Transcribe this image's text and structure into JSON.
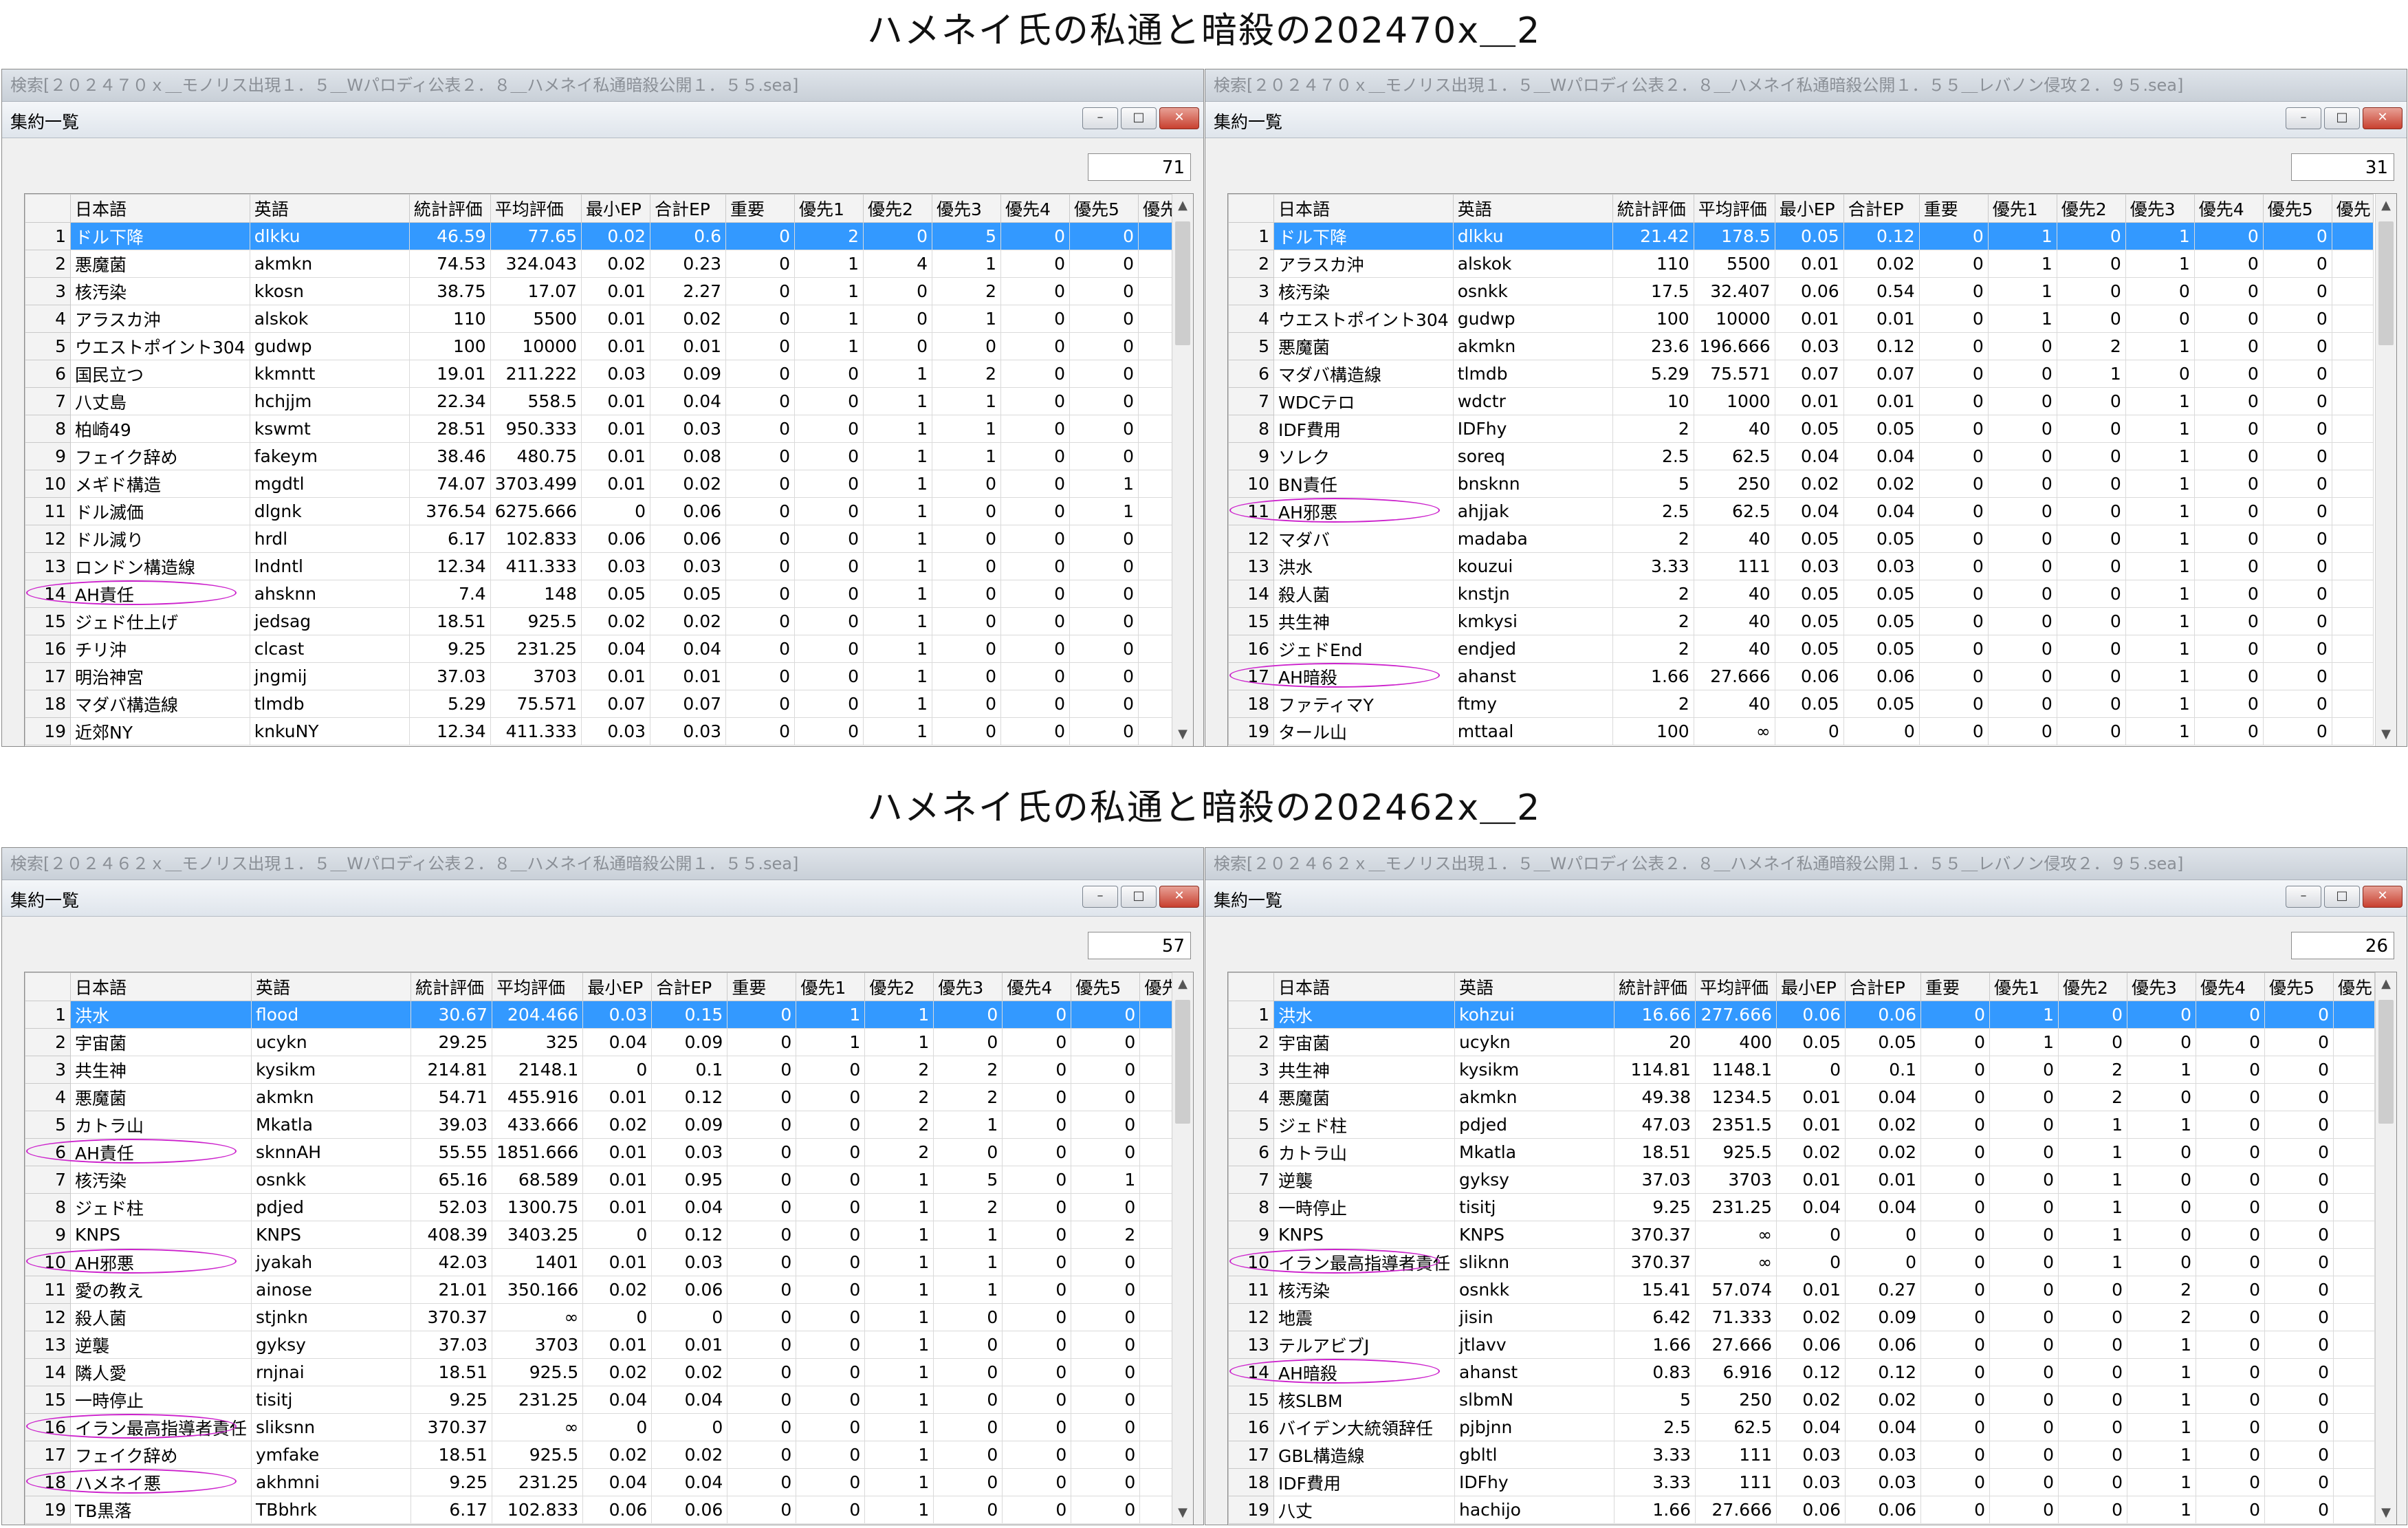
{
  "title_top": "ハメネイ氏の私通と暗殺の202470x＿2",
  "title_bottom": "ハメネイ氏の私通と暗殺の202462x＿2",
  "subwindow_label": "集約一覧",
  "controls": {
    "minimize": "–",
    "maximize": "□",
    "close": "✕"
  },
  "columns": [
    "",
    "日本語",
    "英語",
    "統計評価",
    "平均評価",
    "最小EP",
    "合計EP",
    "重要",
    "優先1",
    "優先2",
    "優先3",
    "優先4",
    "優先5",
    "優先"
  ],
  "highlight_color": "#cc22cc",
  "windows": [
    {
      "title": "検索[２０２４７０ｘ＿モノリス出現１．５＿Wパロディ公表２．８＿ハメネイ私通暗殺公開１．５５.sea]",
      "count": "71",
      "rows": [
        [
          "1",
          "ドル下降",
          "dlkku",
          "46.59",
          "77.65",
          "0.02",
          "0.6",
          "0",
          "2",
          "0",
          "5",
          "0",
          "0"
        ],
        [
          "2",
          "悪魔菌",
          "akmkn",
          "74.53",
          "324.043",
          "0.02",
          "0.23",
          "0",
          "1",
          "4",
          "1",
          "0",
          "0"
        ],
        [
          "3",
          "核汚染",
          "kkosn",
          "38.75",
          "17.07",
          "0.01",
          "2.27",
          "0",
          "1",
          "0",
          "2",
          "0",
          "0"
        ],
        [
          "4",
          "アラスカ沖",
          "alskok",
          "110",
          "5500",
          "0.01",
          "0.02",
          "0",
          "1",
          "0",
          "1",
          "0",
          "0"
        ],
        [
          "5",
          "ウエストポイント304",
          "gudwp",
          "100",
          "10000",
          "0.01",
          "0.01",
          "0",
          "1",
          "0",
          "0",
          "0",
          "0"
        ],
        [
          "6",
          "国民立つ",
          "kkmntt",
          "19.01",
          "211.222",
          "0.03",
          "0.09",
          "0",
          "0",
          "1",
          "2",
          "0",
          "0"
        ],
        [
          "7",
          "八丈島",
          "hchjjm",
          "22.34",
          "558.5",
          "0.01",
          "0.04",
          "0",
          "0",
          "1",
          "1",
          "0",
          "0"
        ],
        [
          "8",
          "柏崎49",
          "kswmt",
          "28.51",
          "950.333",
          "0.01",
          "0.03",
          "0",
          "0",
          "1",
          "1",
          "0",
          "0"
        ],
        [
          "9",
          "フェイク辞め",
          "fakeym",
          "38.46",
          "480.75",
          "0.01",
          "0.08",
          "0",
          "0",
          "1",
          "1",
          "0",
          "0"
        ],
        [
          "10",
          "メギド構造",
          "mgdtl",
          "74.07",
          "3703.499",
          "0.01",
          "0.02",
          "0",
          "0",
          "1",
          "0",
          "0",
          "1"
        ],
        [
          "11",
          "ドル滅価",
          "dlgnk",
          "376.54",
          "6275.666",
          "0",
          "0.06",
          "0",
          "0",
          "1",
          "0",
          "0",
          "1"
        ],
        [
          "12",
          "ドル減り",
          "hrdl",
          "6.17",
          "102.833",
          "0.06",
          "0.06",
          "0",
          "0",
          "1",
          "0",
          "0",
          "0"
        ],
        [
          "13",
          "ロンドン構造線",
          "lndntl",
          "12.34",
          "411.333",
          "0.03",
          "0.03",
          "0",
          "0",
          "1",
          "0",
          "0",
          "0"
        ],
        [
          "14",
          "AH責任",
          "ahsknn",
          "7.4",
          "148",
          "0.05",
          "0.05",
          "0",
          "0",
          "1",
          "0",
          "0",
          "0"
        ],
        [
          "15",
          "ジェド仕上げ",
          "jedsag",
          "18.51",
          "925.5",
          "0.02",
          "0.02",
          "0",
          "0",
          "1",
          "0",
          "0",
          "0"
        ],
        [
          "16",
          "チリ沖",
          "clcast",
          "9.25",
          "231.25",
          "0.04",
          "0.04",
          "0",
          "0",
          "1",
          "0",
          "0",
          "0"
        ],
        [
          "17",
          "明治神宮",
          "jngmij",
          "37.03",
          "3703",
          "0.01",
          "0.01",
          "0",
          "0",
          "1",
          "0",
          "0",
          "0"
        ],
        [
          "18",
          "マダバ構造線",
          "tlmdb",
          "5.29",
          "75.571",
          "0.07",
          "0.07",
          "0",
          "0",
          "1",
          "0",
          "0",
          "0"
        ],
        [
          "19",
          "近郊NY",
          "knkuNY",
          "12.34",
          "411.333",
          "0.03",
          "0.03",
          "0",
          "0",
          "1",
          "0",
          "0",
          "0"
        ]
      ]
    },
    {
      "title": "検索[２０２４７０ｘ＿モノリス出現１．５＿Wパロディ公表２．８＿ハメネイ私通暗殺公開１．５５＿レバノン侵攻２．９５.sea]",
      "count": "31",
      "rows": [
        [
          "1",
          "ドル下降",
          "dlkku",
          "21.42",
          "178.5",
          "0.05",
          "0.12",
          "0",
          "1",
          "0",
          "1",
          "0",
          "0"
        ],
        [
          "2",
          "アラスカ沖",
          "alskok",
          "110",
          "5500",
          "0.01",
          "0.02",
          "0",
          "1",
          "0",
          "1",
          "0",
          "0"
        ],
        [
          "3",
          "核汚染",
          "osnkk",
          "17.5",
          "32.407",
          "0.06",
          "0.54",
          "0",
          "1",
          "0",
          "0",
          "0",
          "0"
        ],
        [
          "4",
          "ウエストポイント304",
          "gudwp",
          "100",
          "10000",
          "0.01",
          "0.01",
          "0",
          "1",
          "0",
          "0",
          "0",
          "0"
        ],
        [
          "5",
          "悪魔菌",
          "akmkn",
          "23.6",
          "196.666",
          "0.03",
          "0.12",
          "0",
          "0",
          "2",
          "1",
          "0",
          "0"
        ],
        [
          "6",
          "マダバ構造線",
          "tlmdb",
          "5.29",
          "75.571",
          "0.07",
          "0.07",
          "0",
          "0",
          "1",
          "0",
          "0",
          "0"
        ],
        [
          "7",
          "WDCテロ",
          "wdctr",
          "10",
          "1000",
          "0.01",
          "0.01",
          "0",
          "0",
          "0",
          "1",
          "0",
          "0"
        ],
        [
          "8",
          "IDF費用",
          "IDFhy",
          "2",
          "40",
          "0.05",
          "0.05",
          "0",
          "0",
          "0",
          "1",
          "0",
          "0"
        ],
        [
          "9",
          "ソレク",
          "soreq",
          "2.5",
          "62.5",
          "0.04",
          "0.04",
          "0",
          "0",
          "0",
          "1",
          "0",
          "0"
        ],
        [
          "10",
          "BN責任",
          "bnsknn",
          "5",
          "250",
          "0.02",
          "0.02",
          "0",
          "0",
          "0",
          "1",
          "0",
          "0"
        ],
        [
          "11",
          "AH邪悪",
          "ahjjak",
          "2.5",
          "62.5",
          "0.04",
          "0.04",
          "0",
          "0",
          "0",
          "1",
          "0",
          "0"
        ],
        [
          "12",
          "マダバ",
          "madaba",
          "2",
          "40",
          "0.05",
          "0.05",
          "0",
          "0",
          "0",
          "1",
          "0",
          "0"
        ],
        [
          "13",
          "洪水",
          "kouzui",
          "3.33",
          "111",
          "0.03",
          "0.03",
          "0",
          "0",
          "0",
          "1",
          "0",
          "0"
        ],
        [
          "14",
          "殺人菌",
          "knstjn",
          "2",
          "40",
          "0.05",
          "0.05",
          "0",
          "0",
          "0",
          "1",
          "0",
          "0"
        ],
        [
          "15",
          "共生神",
          "kmkysi",
          "2",
          "40",
          "0.05",
          "0.05",
          "0",
          "0",
          "0",
          "1",
          "0",
          "0"
        ],
        [
          "16",
          "ジェドEnd",
          "endjed",
          "2",
          "40",
          "0.05",
          "0.05",
          "0",
          "0",
          "0",
          "1",
          "0",
          "0"
        ],
        [
          "17",
          "AH暗殺",
          "ahanst",
          "1.66",
          "27.666",
          "0.06",
          "0.06",
          "0",
          "0",
          "0",
          "1",
          "0",
          "0"
        ],
        [
          "18",
          "ファティマY",
          "ftmy",
          "2",
          "40",
          "0.05",
          "0.05",
          "0",
          "0",
          "0",
          "1",
          "0",
          "0"
        ],
        [
          "19",
          "タール山",
          "mttaal",
          "100",
          "∞",
          "0",
          "0",
          "0",
          "0",
          "0",
          "1",
          "0",
          "0"
        ]
      ]
    },
    {
      "title": "検索[２０２４６２ｘ＿モノリス出現１．５＿Wパロディ公表２．８＿ハメネイ私通暗殺公開１．５５.sea]",
      "count": "57",
      "rows": [
        [
          "1",
          "洪水",
          "flood",
          "30.67",
          "204.466",
          "0.03",
          "0.15",
          "0",
          "1",
          "1",
          "0",
          "0",
          "0"
        ],
        [
          "2",
          "宇宙菌",
          "ucykn",
          "29.25",
          "325",
          "0.04",
          "0.09",
          "0",
          "1",
          "1",
          "0",
          "0",
          "0"
        ],
        [
          "3",
          "共生神",
          "kysikm",
          "214.81",
          "2148.1",
          "0",
          "0.1",
          "0",
          "0",
          "2",
          "2",
          "0",
          "0"
        ],
        [
          "4",
          "悪魔菌",
          "akmkn",
          "54.71",
          "455.916",
          "0.01",
          "0.12",
          "0",
          "0",
          "2",
          "2",
          "0",
          "0"
        ],
        [
          "5",
          "カトラ山",
          "Mkatla",
          "39.03",
          "433.666",
          "0.02",
          "0.09",
          "0",
          "0",
          "2",
          "1",
          "0",
          "0"
        ],
        [
          "6",
          "AH責任",
          "sknnAH",
          "55.55",
          "1851.666",
          "0.01",
          "0.03",
          "0",
          "0",
          "2",
          "0",
          "0",
          "0"
        ],
        [
          "7",
          "核汚染",
          "osnkk",
          "65.16",
          "68.589",
          "0.01",
          "0.95",
          "0",
          "0",
          "1",
          "5",
          "0",
          "1"
        ],
        [
          "8",
          "ジェド柱",
          "pdjed",
          "52.03",
          "1300.75",
          "0.01",
          "0.04",
          "0",
          "0",
          "1",
          "2",
          "0",
          "0"
        ],
        [
          "9",
          "KNPS",
          "KNPS",
          "408.39",
          "3403.25",
          "0",
          "0.12",
          "0",
          "0",
          "1",
          "1",
          "0",
          "2"
        ],
        [
          "10",
          "AH邪悪",
          "jyakah",
          "42.03",
          "1401",
          "0.01",
          "0.03",
          "0",
          "0",
          "1",
          "1",
          "0",
          "0"
        ],
        [
          "11",
          "愛の教え",
          "ainose",
          "21.01",
          "350.166",
          "0.02",
          "0.06",
          "0",
          "0",
          "1",
          "1",
          "0",
          "0"
        ],
        [
          "12",
          "殺人菌",
          "stjnkn",
          "370.37",
          "∞",
          "0",
          "0",
          "0",
          "0",
          "1",
          "0",
          "0",
          "0"
        ],
        [
          "13",
          "逆襲",
          "gyksy",
          "37.03",
          "3703",
          "0.01",
          "0.01",
          "0",
          "0",
          "1",
          "0",
          "0",
          "0"
        ],
        [
          "14",
          "隣人愛",
          "rnjnai",
          "18.51",
          "925.5",
          "0.02",
          "0.02",
          "0",
          "0",
          "1",
          "0",
          "0",
          "0"
        ],
        [
          "15",
          "一時停止",
          "tisitj",
          "9.25",
          "231.25",
          "0.04",
          "0.04",
          "0",
          "0",
          "1",
          "0",
          "0",
          "0"
        ],
        [
          "16",
          "イラン最高指導者責任",
          "sliksnn",
          "370.37",
          "∞",
          "0",
          "0",
          "0",
          "0",
          "1",
          "0",
          "0",
          "0"
        ],
        [
          "17",
          "フェイク辞め",
          "ymfake",
          "18.51",
          "925.5",
          "0.02",
          "0.02",
          "0",
          "0",
          "1",
          "0",
          "0",
          "0"
        ],
        [
          "18",
          "ハメネイ悪",
          "akhmni",
          "9.25",
          "231.25",
          "0.04",
          "0.04",
          "0",
          "0",
          "1",
          "0",
          "0",
          "0"
        ],
        [
          "19",
          "TB黒落",
          "TBbhrk",
          "6.17",
          "102.833",
          "0.06",
          "0.06",
          "0",
          "0",
          "1",
          "0",
          "0",
          "0"
        ]
      ]
    },
    {
      "title": "検索[２０２４６２ｘ＿モノリス出現１．５＿Wパロディ公表２．８＿ハメネイ私通暗殺公開１．５５＿レバノン侵攻２．９５.sea]",
      "count": "26",
      "rows": [
        [
          "1",
          "洪水",
          "kohzui",
          "16.66",
          "277.666",
          "0.06",
          "0.06",
          "0",
          "1",
          "0",
          "0",
          "0",
          "0"
        ],
        [
          "2",
          "宇宙菌",
          "ucykn",
          "20",
          "400",
          "0.05",
          "0.05",
          "0",
          "1",
          "0",
          "0",
          "0",
          "0"
        ],
        [
          "3",
          "共生神",
          "kysikm",
          "114.81",
          "1148.1",
          "0",
          "0.1",
          "0",
          "0",
          "2",
          "1",
          "0",
          "0"
        ],
        [
          "4",
          "悪魔菌",
          "akmkn",
          "49.38",
          "1234.5",
          "0.01",
          "0.04",
          "0",
          "0",
          "2",
          "0",
          "0",
          "0"
        ],
        [
          "5",
          "ジェド柱",
          "pdjed",
          "47.03",
          "2351.5",
          "0.01",
          "0.02",
          "0",
          "0",
          "1",
          "1",
          "0",
          "0"
        ],
        [
          "6",
          "カトラ山",
          "Mkatla",
          "18.51",
          "925.5",
          "0.02",
          "0.02",
          "0",
          "0",
          "1",
          "0",
          "0",
          "0"
        ],
        [
          "7",
          "逆襲",
          "gyksy",
          "37.03",
          "3703",
          "0.01",
          "0.01",
          "0",
          "0",
          "1",
          "0",
          "0",
          "0"
        ],
        [
          "8",
          "一時停止",
          "tisitj",
          "9.25",
          "231.25",
          "0.04",
          "0.04",
          "0",
          "0",
          "1",
          "0",
          "0",
          "0"
        ],
        [
          "9",
          "KNPS",
          "KNPS",
          "370.37",
          "∞",
          "0",
          "0",
          "0",
          "0",
          "1",
          "0",
          "0",
          "0"
        ],
        [
          "10",
          "イラン最高指導者責任",
          "sliknn",
          "370.37",
          "∞",
          "0",
          "0",
          "0",
          "0",
          "1",
          "0",
          "0",
          "0"
        ],
        [
          "11",
          "核汚染",
          "osnkk",
          "15.41",
          "57.074",
          "0.01",
          "0.27",
          "0",
          "0",
          "0",
          "2",
          "0",
          "0"
        ],
        [
          "12",
          "地震",
          "jisin",
          "6.42",
          "71.333",
          "0.02",
          "0.09",
          "0",
          "0",
          "0",
          "2",
          "0",
          "0"
        ],
        [
          "13",
          "テルアビブJ",
          "jtlavv",
          "1.66",
          "27.666",
          "0.06",
          "0.06",
          "0",
          "0",
          "0",
          "1",
          "0",
          "0"
        ],
        [
          "14",
          "AH暗殺",
          "ahanst",
          "0.83",
          "6.916",
          "0.12",
          "0.12",
          "0",
          "0",
          "0",
          "1",
          "0",
          "0"
        ],
        [
          "15",
          "核SLBM",
          "slbmN",
          "5",
          "250",
          "0.02",
          "0.02",
          "0",
          "0",
          "0",
          "1",
          "0",
          "0"
        ],
        [
          "16",
          "バイデン大統領辞任",
          "pjbjnn",
          "2.5",
          "62.5",
          "0.04",
          "0.04",
          "0",
          "0",
          "0",
          "1",
          "0",
          "0"
        ],
        [
          "17",
          "GBL構造線",
          "gbltl",
          "3.33",
          "111",
          "0.03",
          "0.03",
          "0",
          "0",
          "0",
          "1",
          "0",
          "0"
        ],
        [
          "18",
          "IDF費用",
          "IDFhy",
          "3.33",
          "111",
          "0.03",
          "0.03",
          "0",
          "0",
          "0",
          "1",
          "0",
          "0"
        ],
        [
          "19",
          "八丈",
          "hachijo",
          "1.66",
          "27.666",
          "0.06",
          "0.06",
          "0",
          "0",
          "0",
          "1",
          "0",
          "0"
        ]
      ]
    }
  ]
}
